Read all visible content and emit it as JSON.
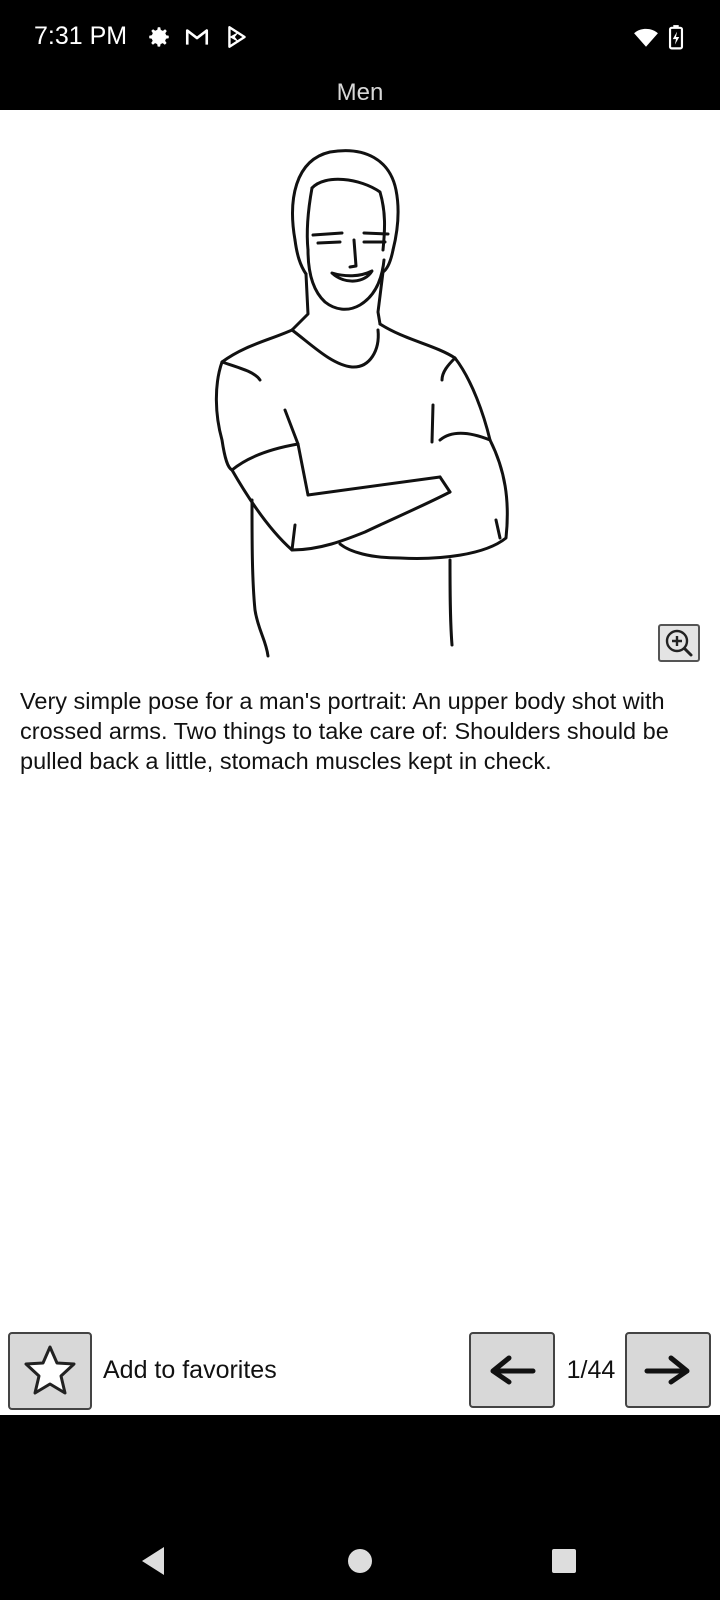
{
  "status_bar": {
    "time": "7:31 PM",
    "icons": [
      "gear-icon",
      "gmail-icon",
      "play-store-icon",
      "wifi-icon",
      "battery-charging-icon"
    ]
  },
  "header": {
    "title": "Men"
  },
  "pose": {
    "image": "man-crossed-arms-sketch",
    "description": "Very simple pose for a man's portrait: An upper body shot with crossed arms. Two things to take care of: Shoulders should be pulled back a little, stomach muscles kept in check."
  },
  "toolbar": {
    "favorites_label": "Add to favorites",
    "page_counter": "1/44",
    "current_page": 1,
    "total_pages": 44
  },
  "nav_bar": {
    "icons": [
      "back-icon",
      "home-icon",
      "recents-icon"
    ]
  },
  "colors": {
    "background": "#ffffff",
    "bars": "#000000",
    "button_fill": "#d8d8d8"
  }
}
